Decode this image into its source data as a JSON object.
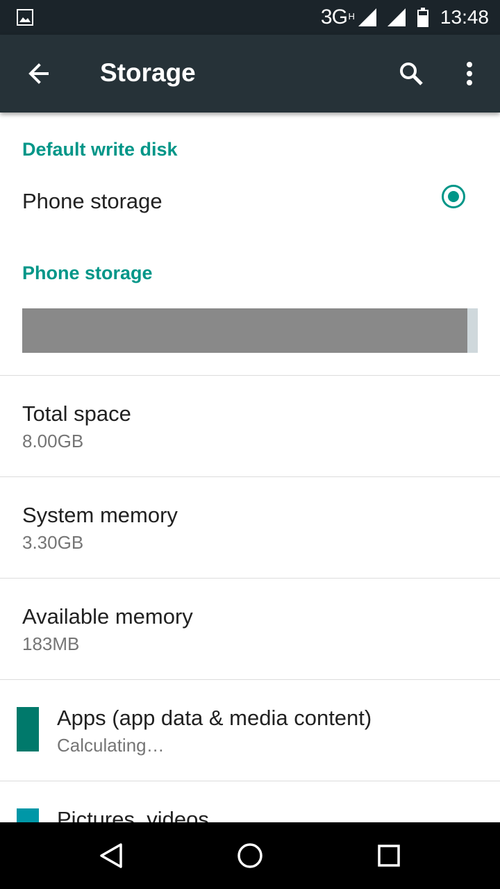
{
  "status_bar": {
    "network": "3G",
    "network_sub": "H",
    "time": "13:48"
  },
  "app_bar": {
    "title": "Storage",
    "icons": [
      "back-arrow-icon",
      "search-icon",
      "more-vert-icon"
    ]
  },
  "default_write_disk": {
    "header": "Default write disk",
    "option_label": "Phone storage",
    "selected": true
  },
  "phone_storage": {
    "header": "Phone storage",
    "usage_fraction": 0.977,
    "colors": {
      "used": "#898989",
      "free": "#cfd8dc"
    },
    "rows": [
      {
        "title": "Total space",
        "value": "8.00GB"
      },
      {
        "title": "System memory",
        "value": "3.30GB"
      },
      {
        "title": "Available memory",
        "value": "183MB"
      }
    ],
    "categories": [
      {
        "title": "Apps (app data & media content)",
        "value": "Calculating…",
        "color": "#00796b"
      },
      {
        "title": "Pictures, videos",
        "value": "",
        "color": "#0097a7"
      }
    ]
  },
  "theme": {
    "accent": "#009688",
    "app_bar": "#263238",
    "status_bar": "#1b242a"
  }
}
